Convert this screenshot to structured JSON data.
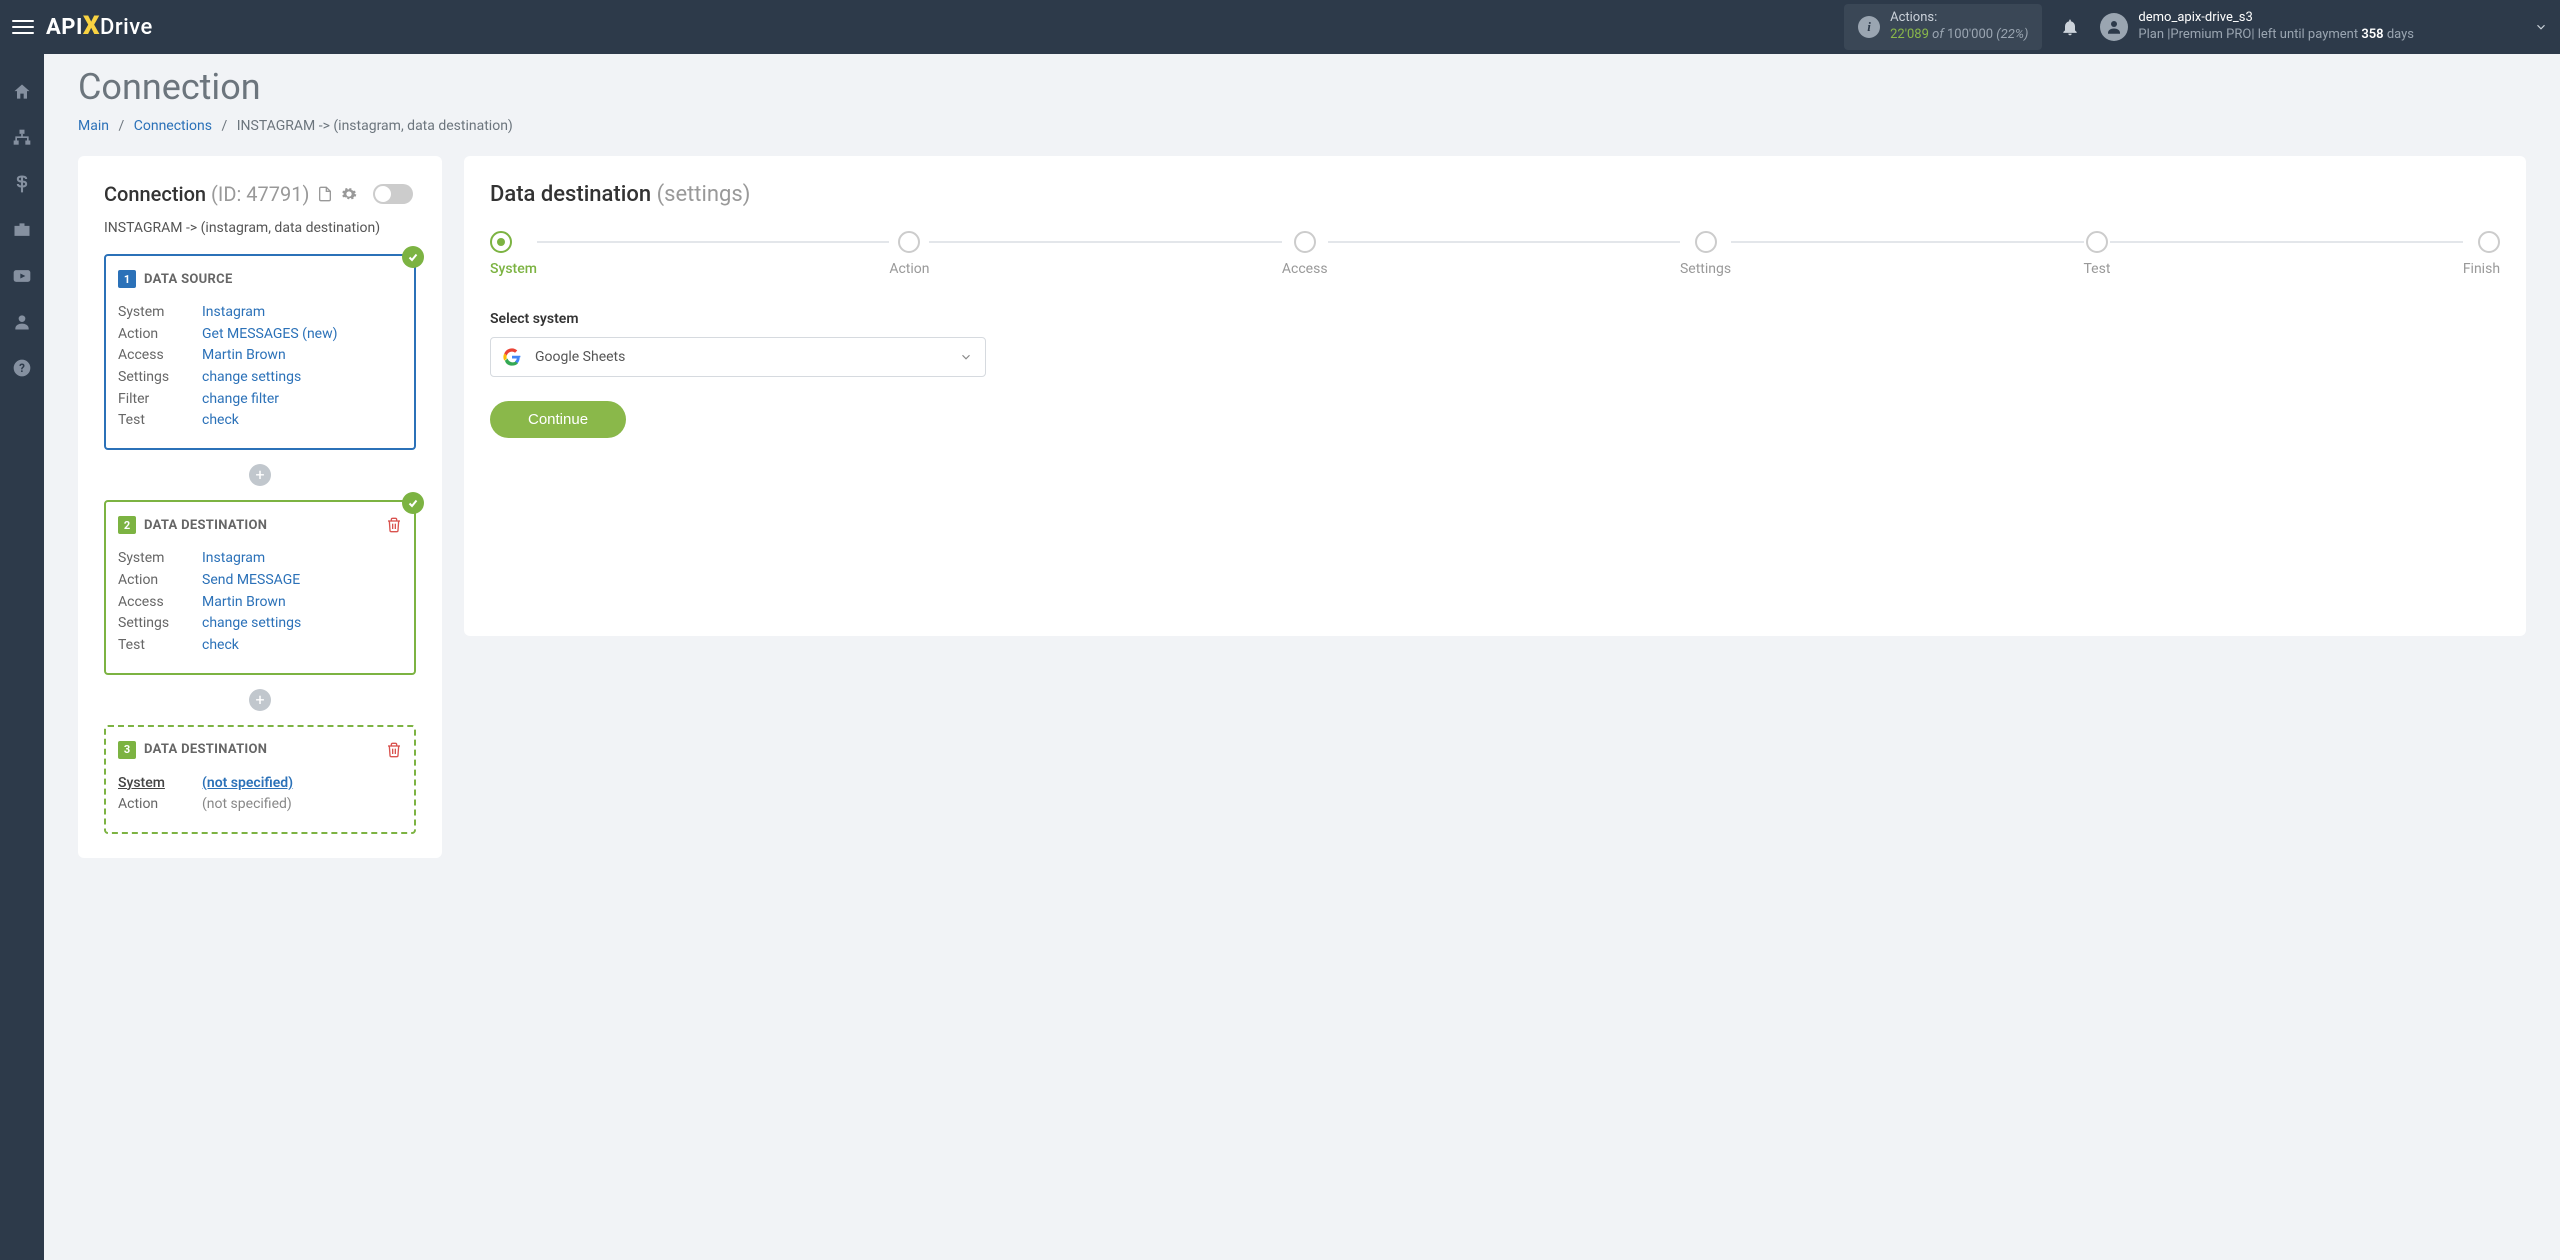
{
  "topbar": {
    "actions": {
      "label": "Actions:",
      "count": "22'089",
      "of": "of",
      "total": "100'000",
      "pct": "(22%)"
    },
    "user": {
      "name": "demo_apix-drive_s3",
      "plan_prefix": "Plan |Premium PRO| left until payment",
      "days": "358",
      "days_suffix": "days"
    }
  },
  "page": {
    "title": "Connection",
    "breadcrumb": {
      "main": "Main",
      "connections": "Connections",
      "current": "INSTAGRAM -> (instagram, data destination)"
    }
  },
  "left": {
    "title_prefix": "Connection",
    "id_label": "(ID: 47791)",
    "subtitle": "INSTAGRAM -> (instagram, data destination)",
    "source": {
      "num": "1",
      "title": "DATA SOURCE",
      "rows": {
        "system_k": "System",
        "system_v": "Instagram",
        "action_k": "Action",
        "action_v": "Get MESSAGES (new)",
        "access_k": "Access",
        "access_v": "Martin Brown",
        "settings_k": "Settings",
        "settings_v": "change settings",
        "filter_k": "Filter",
        "filter_v": "change filter",
        "test_k": "Test",
        "test_v": "check"
      }
    },
    "dest1": {
      "num": "2",
      "title": "DATA DESTINATION",
      "rows": {
        "system_k": "System",
        "system_v": "Instagram",
        "action_k": "Action",
        "action_v": "Send MESSAGE",
        "access_k": "Access",
        "access_v": "Martin Brown",
        "settings_k": "Settings",
        "settings_v": "change settings",
        "test_k": "Test",
        "test_v": "check"
      }
    },
    "dest2": {
      "num": "3",
      "title": "DATA DESTINATION",
      "rows": {
        "system_k": "System",
        "system_v": "(not specified)",
        "action_k": "Action",
        "action_v": "(not specified)"
      }
    }
  },
  "right": {
    "title": "Data destination",
    "subtitle": "(settings)",
    "steps": [
      "System",
      "Action",
      "Access",
      "Settings",
      "Test",
      "Finish"
    ],
    "field_label": "Select system",
    "select_value": "Google Sheets",
    "continue": "Continue"
  }
}
